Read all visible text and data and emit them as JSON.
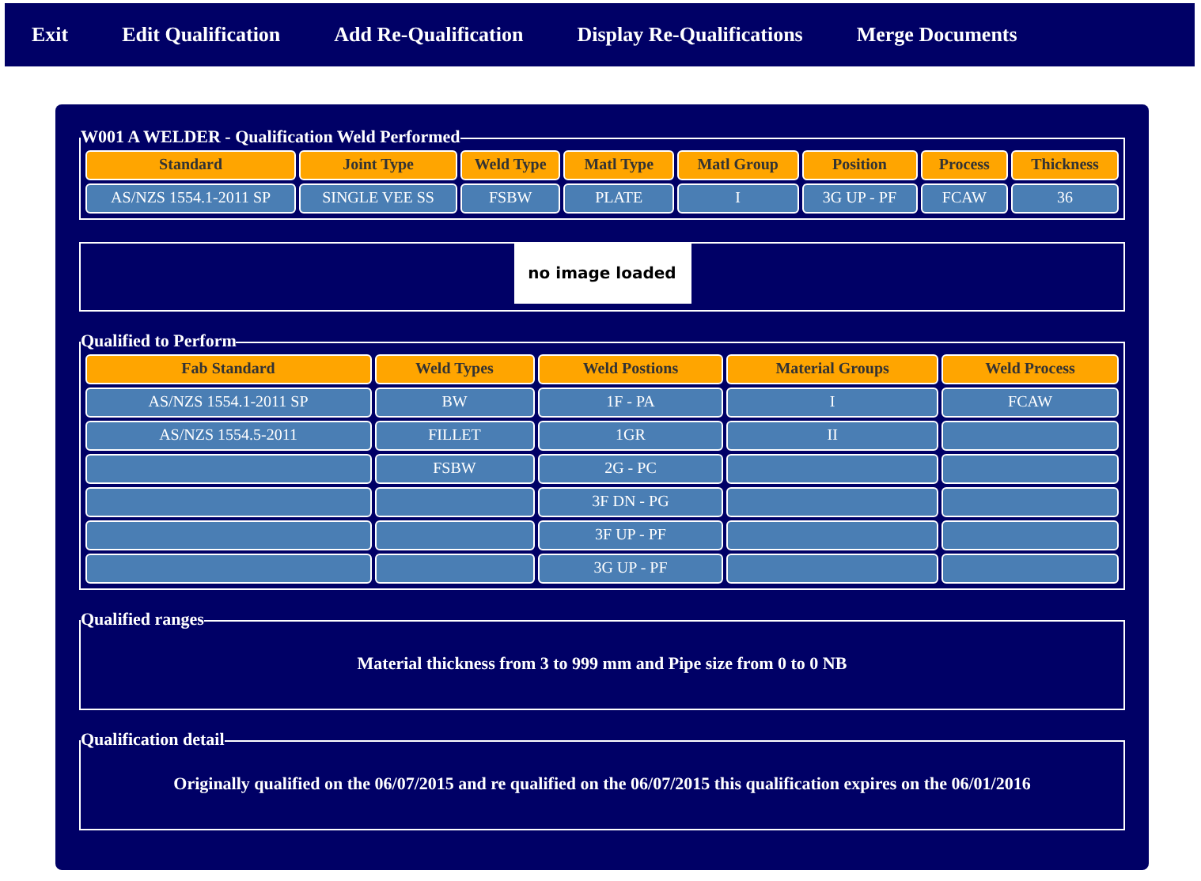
{
  "menu": [
    {
      "label": "Exit"
    },
    {
      "label": "Edit Qualification"
    },
    {
      "label": "Add Re-Qualification"
    },
    {
      "label": "Display Re-Qualifications"
    },
    {
      "label": "Merge Documents"
    }
  ],
  "weld_performed": {
    "legend": "W001 A WELDER - Qualification Weld Performed",
    "columns": [
      "Standard",
      "Joint Type",
      "Weld Type",
      "Matl Type",
      "Matl Group",
      "Position",
      "Process",
      "Thickness"
    ],
    "rows": [
      [
        "AS/NZS 1554.1-2011 SP",
        "SINGLE VEE SS",
        "FSBW",
        "PLATE",
        "I",
        "3G UP - PF",
        "FCAW",
        "36"
      ]
    ]
  },
  "image": {
    "text": "no image loaded"
  },
  "qualified_to_perform": {
    "legend": "Qualified to Perform",
    "columns": [
      "Fab Standard",
      "Weld Types",
      "Weld Postions",
      "Material Groups",
      "Weld Process"
    ],
    "rows": [
      [
        "AS/NZS 1554.1-2011 SP",
        "BW",
        "1F - PA",
        "I",
        "FCAW"
      ],
      [
        "AS/NZS 1554.5-2011",
        "FILLET",
        "1GR",
        "II",
        null
      ],
      [
        null,
        "FSBW",
        "2G - PC",
        null,
        null
      ],
      [
        null,
        null,
        "3F DN - PG",
        null,
        null
      ],
      [
        null,
        null,
        "3F UP - PF",
        null,
        null
      ],
      [
        null,
        null,
        "3G UP - PF",
        null,
        null
      ]
    ]
  },
  "qualified_ranges": {
    "legend": "Qualified ranges",
    "text": "Material thickness from 3 to 999 mm and Pipe size from 0 to 0 NB"
  },
  "qualification_detail": {
    "legend": "Qualification detail",
    "text": "Originally qualified on the 06/07/2015 and re qualified on the 06/07/2015 this qualification expires on the 06/01/2016"
  }
}
